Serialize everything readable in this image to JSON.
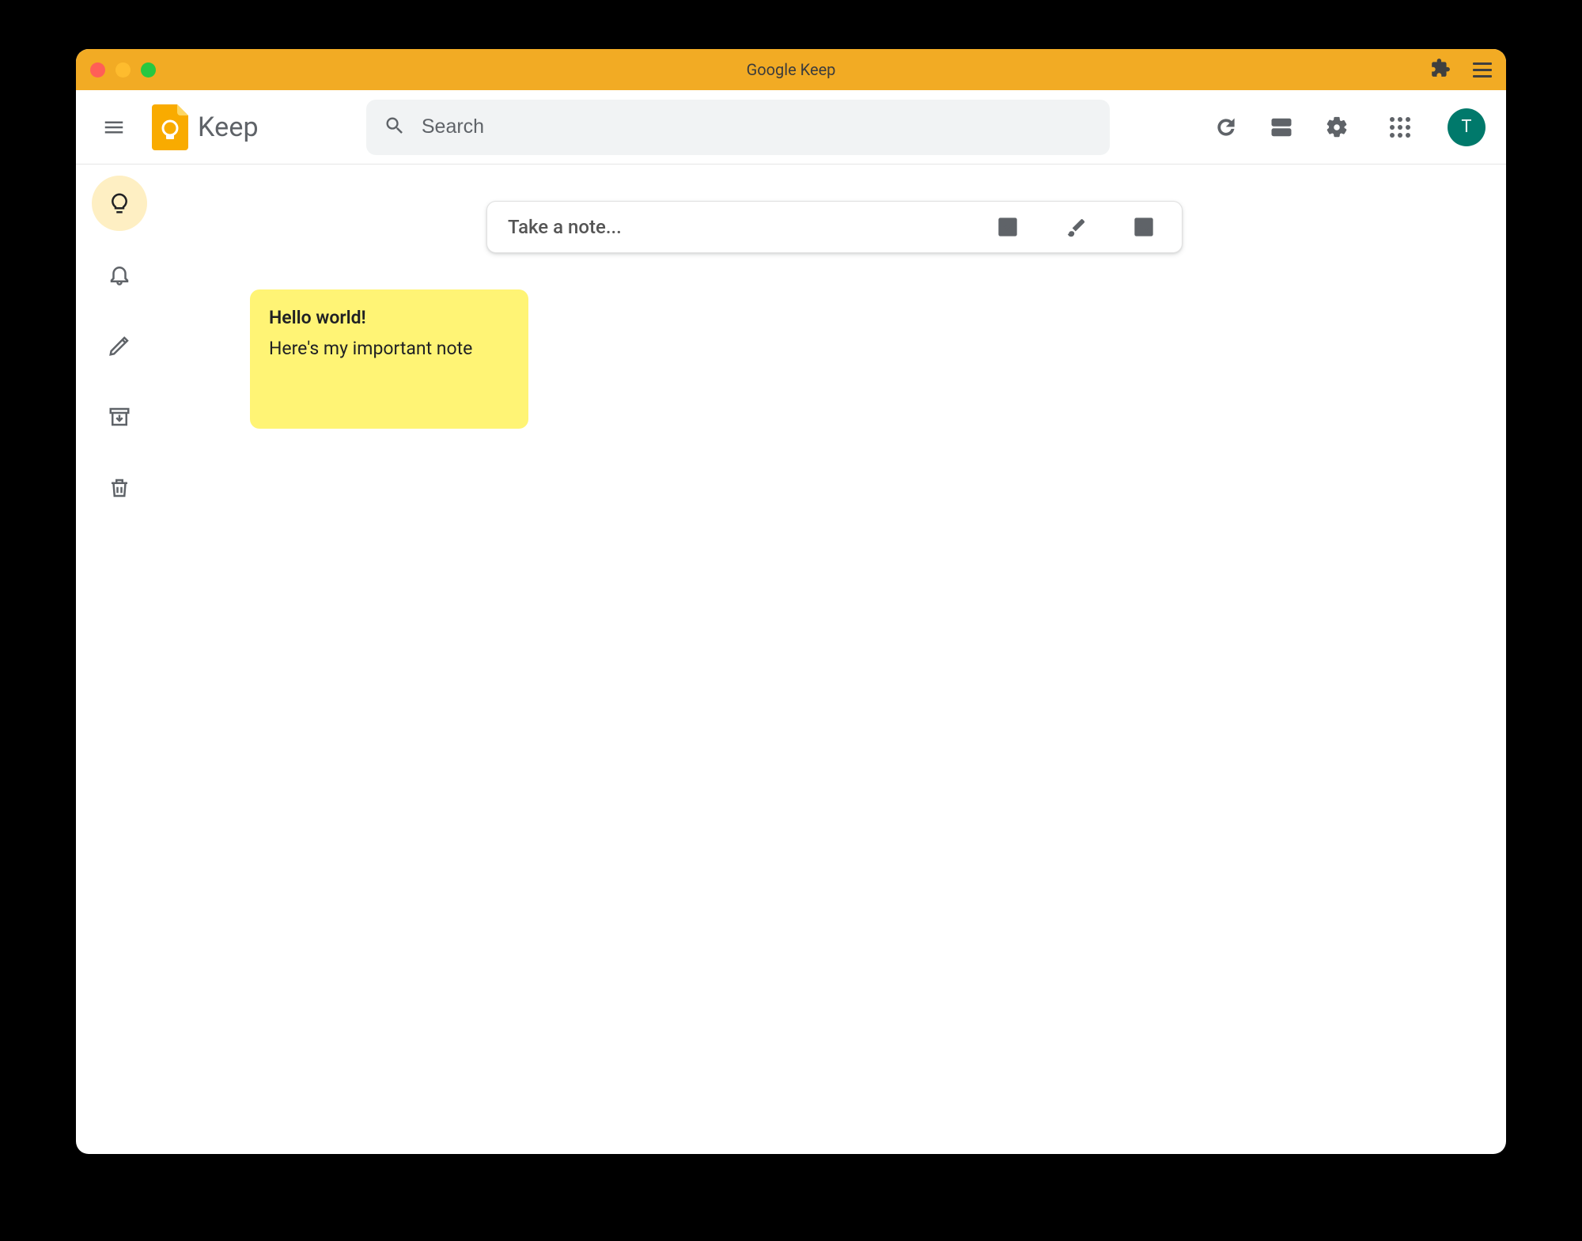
{
  "window": {
    "title": "Google Keep"
  },
  "header": {
    "logo_text": "Keep",
    "search_placeholder": "Search",
    "avatar_initial": "T"
  },
  "sidebar": {
    "items": [
      {
        "icon": "lightbulb",
        "active": true
      },
      {
        "icon": "bell",
        "active": false
      },
      {
        "icon": "pencil",
        "active": false
      },
      {
        "icon": "archive",
        "active": false
      },
      {
        "icon": "trash",
        "active": false
      }
    ]
  },
  "take_note": {
    "placeholder": "Take a note..."
  },
  "notes": [
    {
      "title": "Hello world!",
      "body": "Here's my important note",
      "color": "yellow"
    }
  ]
}
